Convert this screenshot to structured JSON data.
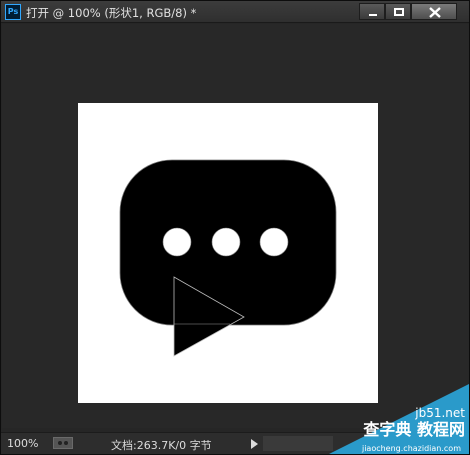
{
  "app": {
    "icon_label": "Ps",
    "title": "打开 @ 100% (形状1, RGB/8) *"
  },
  "status": {
    "zoom": "100%",
    "doc_info": "文档:263.7K/0 字节"
  },
  "canvas": {
    "background_color": "#282828",
    "document_color": "#ffffff",
    "shape_color": "#000000",
    "dot_count": 3
  },
  "watermark": {
    "site": "jb51.net",
    "name": "查字典 教程网",
    "url": "jiaocheng.chazidian.com"
  }
}
